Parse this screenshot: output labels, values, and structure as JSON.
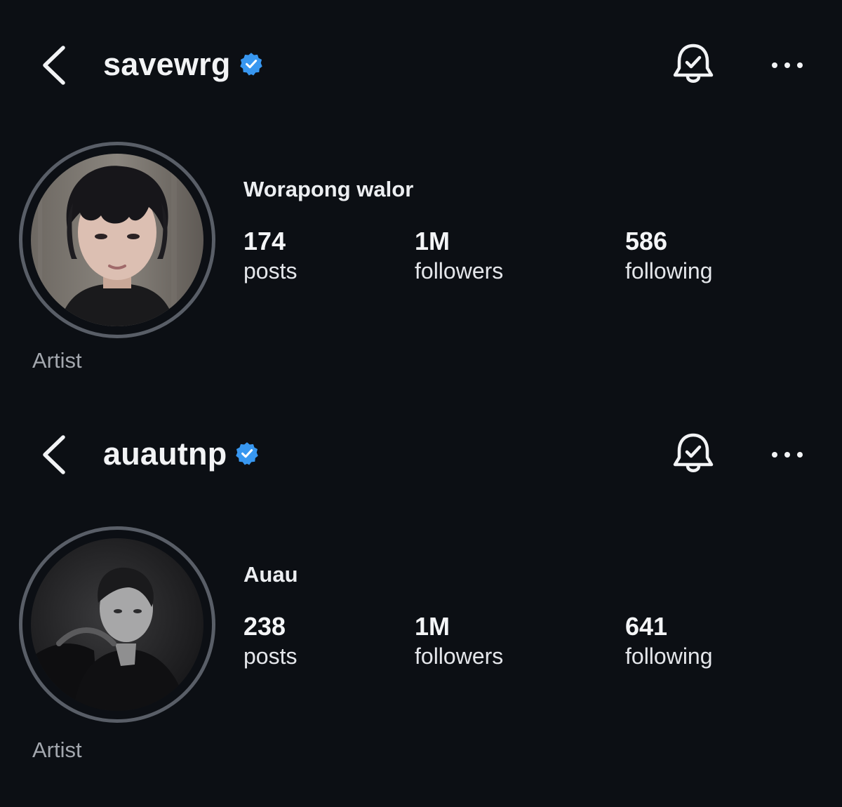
{
  "profiles": [
    {
      "username": "savewrg",
      "display_name": "Worapong walor",
      "stats": {
        "posts": {
          "value": "174",
          "label": "posts"
        },
        "followers": {
          "value": "1M",
          "label": "followers"
        },
        "following": {
          "value": "586",
          "label": "following"
        }
      },
      "category": "Artist",
      "icons": {
        "back": "chevron-left-icon",
        "verified": "verified-badge-icon",
        "notifications": "bell-check-icon",
        "more": "more-horizontal-icon"
      }
    },
    {
      "username": "auautnp",
      "display_name": "Auau",
      "stats": {
        "posts": {
          "value": "238",
          "label": "posts"
        },
        "followers": {
          "value": "1M",
          "label": "followers"
        },
        "following": {
          "value": "641",
          "label": "following"
        }
      },
      "category": "Artist",
      "icons": {
        "back": "chevron-left-icon",
        "verified": "verified-badge-icon",
        "notifications": "bell-check-icon",
        "more": "more-horizontal-icon"
      }
    }
  ],
  "colors": {
    "background": "#0c0f14",
    "verified": "#3897f0",
    "text": "#f2f3f5",
    "secondary_text": "#a3a7ae",
    "avatar_ring": "#595e67"
  }
}
